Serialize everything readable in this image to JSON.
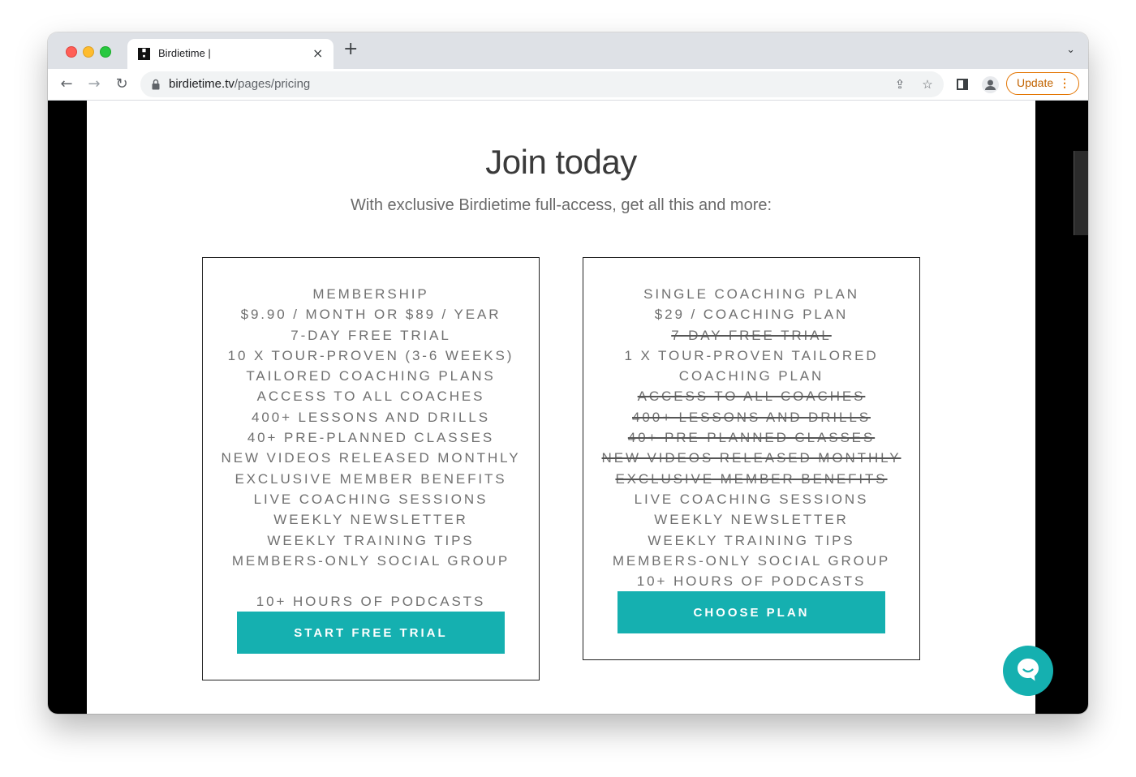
{
  "browser": {
    "tab_title": "Birdietime |",
    "tab_close": "×",
    "new_tab": "+",
    "tab_menu": "⌄",
    "url_domain": "birdietime.tv",
    "url_path": "/pages/pricing",
    "update_label": "Update",
    "update_dots": "⋮",
    "icons": {
      "back": "←",
      "forward": "→",
      "reload": "↻",
      "share": "⇪",
      "star": "☆"
    }
  },
  "page": {
    "heading": "Join today",
    "subheading": "With exclusive Birdietime full-access, get all this and more:",
    "accent_color": "#15b0b0",
    "plans": [
      {
        "features": [
          {
            "text": "MEMBERSHIP",
            "struck": false
          },
          {
            "text": "$9.90 / MONTH OR $89 / YEAR",
            "struck": false
          },
          {
            "text": "7-DAY FREE TRIAL",
            "struck": false
          },
          {
            "text": "10 X TOUR-PROVEN (3-6 WEEKS)",
            "struck": false
          },
          {
            "text": "TAILORED COACHING PLANS",
            "struck": false
          },
          {
            "text": "ACCESS TO ALL COACHES",
            "struck": false
          },
          {
            "text": "400+ LESSONS AND DRILLS",
            "struck": false
          },
          {
            "text": "40+ PRE-PLANNED CLASSES",
            "struck": false
          },
          {
            "text": "NEW VIDEOS RELEASED MONTHLY",
            "struck": false
          },
          {
            "text": "EXCLUSIVE MEMBER BENEFITS",
            "struck": false
          },
          {
            "text": "LIVE COACHING SESSIONS",
            "struck": false
          },
          {
            "text": "WEEKLY NEWSLETTER",
            "struck": false
          },
          {
            "text": "WEEKLY TRAINING TIPS",
            "struck": false
          },
          {
            "text": "MEMBERS-ONLY SOCIAL GROUP",
            "struck": false
          },
          {
            "text": "10+ HOURS OF PODCASTS",
            "struck": false
          }
        ],
        "cta_label": "START FREE TRIAL"
      },
      {
        "features": [
          {
            "text": "SINGLE COACHING PLAN",
            "struck": false
          },
          {
            "text": "$29 / COACHING PLAN",
            "struck": false
          },
          {
            "text": "7-DAY FREE TRIAL",
            "struck": true
          },
          {
            "text": "1 X TOUR-PROVEN TAILORED",
            "struck": false
          },
          {
            "text": "COACHING PLAN",
            "struck": false
          },
          {
            "text": "ACCESS TO ALL COACHES",
            "struck": true
          },
          {
            "text": "400+ LESSONS AND DRILLS",
            "struck": true
          },
          {
            "text": "40+ PRE-PLANNED CLASSES",
            "struck": true
          },
          {
            "text": "NEW VIDEOS RELEASED MONTHLY",
            "struck": true
          },
          {
            "text": "EXCLUSIVE MEMBER BENEFITS",
            "struck": true
          },
          {
            "text": "LIVE COACHING SESSIONS",
            "struck": false
          },
          {
            "text": "WEEKLY NEWSLETTER",
            "struck": false
          },
          {
            "text": "WEEKLY TRAINING TIPS",
            "struck": false
          },
          {
            "text": "MEMBERS-ONLY SOCIAL GROUP",
            "struck": false
          },
          {
            "text": "10+ HOURS OF PODCASTS",
            "struck": false
          }
        ],
        "cta_label": "CHOOSE PLAN"
      }
    ]
  }
}
